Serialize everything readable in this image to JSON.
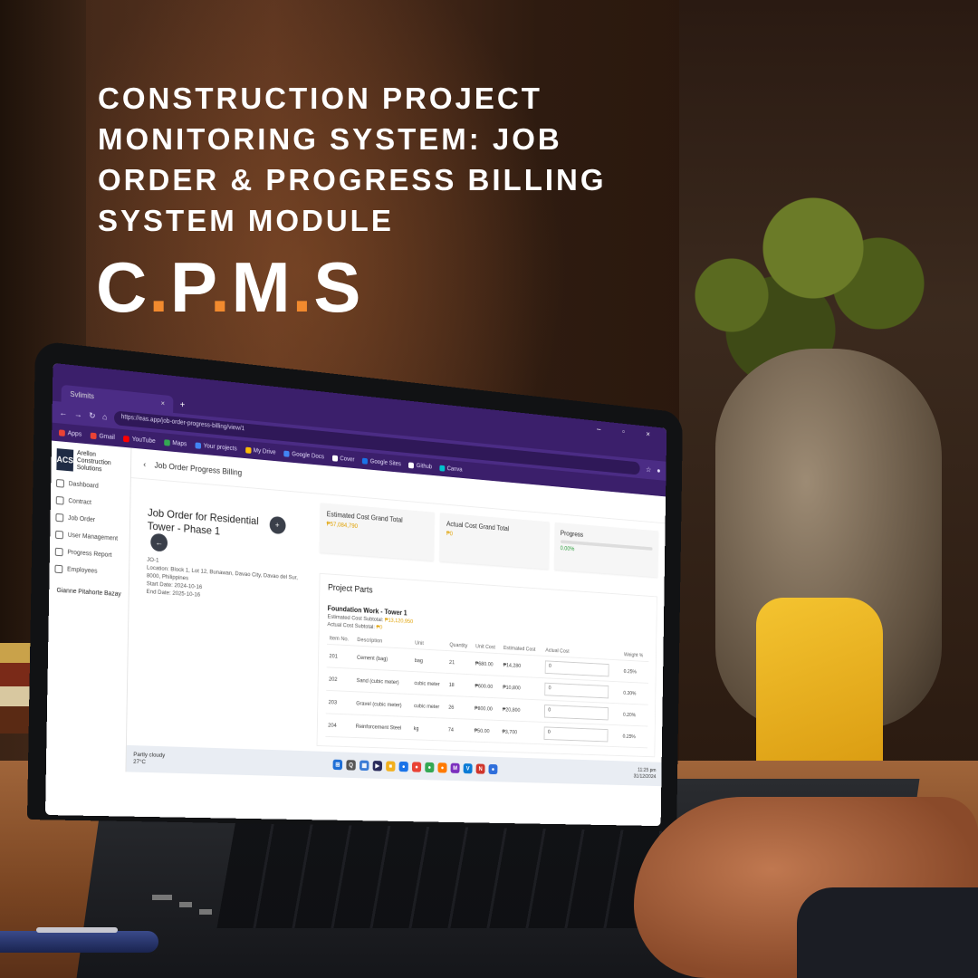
{
  "headline": {
    "line1": "Construction Project",
    "line2": "Monitoring System: Job",
    "line3": "Order & Progress Billing",
    "line4": "System Module"
  },
  "logo": {
    "c": "C",
    "p": "P",
    "m": "M",
    "s": "S",
    "dot": ".",
    "accent_color": "#f28a2e"
  },
  "browser": {
    "tab_title": "Svlimits",
    "tab_close": "×",
    "tab_plus": "+",
    "window_controls": "– ▫ ×",
    "nav_icons": [
      "back-icon",
      "forward-icon",
      "reload-icon",
      "home-icon"
    ],
    "url_text": "https://eas.app/job-order-progress-billing/view/1",
    "bookmarks": [
      "Apps",
      "Gmail",
      "YouTube",
      "Maps",
      "Your projects",
      "My Drive",
      "Google Docs",
      "Cover",
      "Google Sites",
      "Github",
      "Canva"
    ]
  },
  "sidebar": {
    "brand_mark": "ACS",
    "brand_name": "Arellon Construction Solutions",
    "items": [
      {
        "label": "Dashboard",
        "icon": "dashboard-icon"
      },
      {
        "label": "Contract",
        "icon": "contract-icon"
      },
      {
        "label": "Job Order",
        "icon": "job-order-icon"
      },
      {
        "label": "User Management",
        "icon": "users-icon"
      },
      {
        "label": "Progress Report",
        "icon": "chart-icon"
      },
      {
        "label": "Employees",
        "icon": "employees-icon"
      }
    ],
    "user_name": "Gianne Pitahorte Bazay"
  },
  "main": {
    "back_glyph": "‹",
    "page_title": "Job Order Progress Billing",
    "job_order": {
      "title": "Job Order for Residential Tower - Phase 1",
      "id": "JO-1",
      "location": "Location: Block 1, Lot 12, Bunawan, Davao City, Davao del Sur, 8000, Philippines",
      "start_date": "Start Date: 2024-10-16",
      "end_date": "End Date: 2025-10-16",
      "add_btn": "+",
      "back_btn": "←"
    },
    "cards": {
      "estimated_label": "Estimated Cost Grand Total",
      "estimated_value": "₱57,084,790",
      "actual_label": "Actual Cost Grand Total",
      "actual_value": "₱0",
      "progress_label": "Progress",
      "progress_value": "0.00%",
      "progress_fraction": 0.0
    },
    "project_parts": {
      "title": "Project Parts",
      "part_name": "Foundation Work - Tower 1",
      "estimated_subtotal_label": "Estimated Cost Subtotal:",
      "estimated_subtotal": "₱13,120,950",
      "actual_subtotal_label": "Actual Cost Subtotal:",
      "actual_subtotal": "₱0",
      "columns": [
        "Item No.",
        "Description",
        "Unit",
        "Quantity",
        "Unit Cost",
        "Estimated Cost",
        "Actual Cost",
        "Weight %"
      ],
      "rows": [
        {
          "item": "201",
          "desc": "Cement (bag)",
          "unit": "bag",
          "qty": "21",
          "unit_cost": "₱680.00",
          "est": "₱14,280",
          "actual": "0",
          "weight": "0.25%"
        },
        {
          "item": "202",
          "desc": "Sand (cubic meter)",
          "unit": "cubic meter",
          "qty": "18",
          "unit_cost": "₱600.00",
          "est": "₱10,800",
          "actual": "0",
          "weight": "0.20%"
        },
        {
          "item": "203",
          "desc": "Gravel (cubic meter)",
          "unit": "cubic meter",
          "qty": "26",
          "unit_cost": "₱800.00",
          "est": "₱20,800",
          "actual": "0",
          "weight": "0.20%"
        },
        {
          "item": "204",
          "desc": "Reinforcement Steel",
          "unit": "kg",
          "qty": "74",
          "unit_cost": "₱50.00",
          "est": "₱3,700",
          "actual": "0",
          "weight": "0.25%"
        }
      ]
    }
  },
  "taskbar": {
    "weather_line1": "Partly cloudy",
    "weather_line2": "27°C",
    "tray_line1": "11:25 pm",
    "tray_line2": "31/12/2024",
    "icons": [
      {
        "glyph": "⊞",
        "color": "#1f6fd6",
        "name": "windows-start-icon"
      },
      {
        "glyph": "Q",
        "color": "#555555",
        "name": "search-icon"
      },
      {
        "glyph": "▦",
        "color": "#3a7bd5",
        "name": "task-view-icon"
      },
      {
        "glyph": "▶",
        "color": "#2a2a5a",
        "name": "terminal-icon"
      },
      {
        "glyph": "■",
        "color": "#f2b01e",
        "name": "file-explorer-icon"
      },
      {
        "glyph": "●",
        "color": "#1a73e8",
        "name": "edge-icon"
      },
      {
        "glyph": "●",
        "color": "#e94235",
        "name": "chrome-icon"
      },
      {
        "glyph": "●",
        "color": "#34a853",
        "name": "chrome-profile-icon"
      },
      {
        "glyph": "●",
        "color": "#ff7a00",
        "name": "firefox-icon"
      },
      {
        "glyph": "M",
        "color": "#7b2fbe",
        "name": "mail-icon"
      },
      {
        "glyph": "V",
        "color": "#0a7bd6",
        "name": "vscode-icon"
      },
      {
        "glyph": "N",
        "color": "#d0352b",
        "name": "app-icon"
      },
      {
        "glyph": "●",
        "color": "#2f6fdb",
        "name": "app-icon-2"
      }
    ]
  }
}
